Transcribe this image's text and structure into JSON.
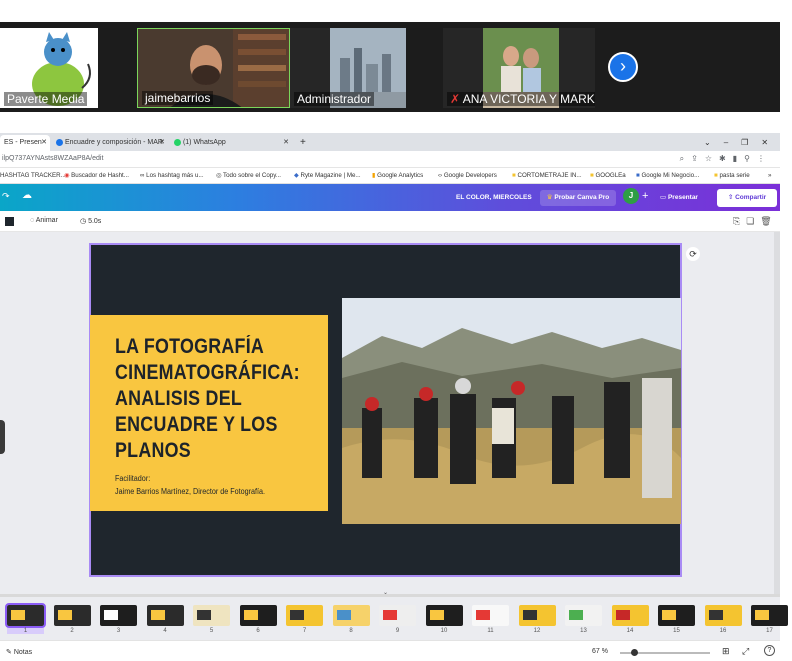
{
  "meeting": {
    "participants": [
      {
        "name": "Paverte Media"
      },
      {
        "name": "jaimebarrios"
      },
      {
        "name": "Administrador"
      },
      {
        "name": "ANA VICTORIA Y MARK"
      }
    ],
    "next_icon": "chevron-right-icon"
  },
  "browser": {
    "tabs": [
      {
        "label": "ES - Presen"
      },
      {
        "label": "Encuadre y composición - MAR"
      },
      {
        "label": "(1) WhatsApp"
      }
    ],
    "new_tab": "+",
    "url": "ilpQ737AYNAsts8WZAaP8A/edit",
    "bookmarks": [
      "HASHTAG TRACKER...",
      "Buscador de Hasht...",
      "Los hashtag más u...",
      "Todo sobre el Copy...",
      "Ryte Magazine | Me...",
      "Google Analytics",
      "Google Developers",
      "CORTOMETRAJE IN...",
      "GOOGLEa",
      "Google Mi Negocio...",
      "pasta serie"
    ]
  },
  "canva": {
    "header": {
      "design_name": "EL COLOR, MIERCOLES",
      "pro_button": "Probar Canva Pro",
      "avatar_initial": "J",
      "add_label": "+",
      "present_button": "Presentar",
      "share_button": "Compartir"
    },
    "toolbar": {
      "animate": "Animar",
      "duration": "5.0s"
    },
    "slide": {
      "title": "LA FOTOGRAFÍA CINEMATOGRÁFICA: ANALISIS DEL ENCUADRE Y LOS PLANOS",
      "facilitator_label": "Facilitador:",
      "facilitator_name": "Jaime Barrios Martínez, Director de Fotografía."
    },
    "filmstrip": {
      "numbers": [
        "1",
        "2",
        "3",
        "4",
        "5",
        "6",
        "7",
        "8",
        "9",
        "10",
        "11",
        "12",
        "13",
        "14",
        "15",
        "16",
        "17"
      ]
    },
    "footer": {
      "notes": "Notas",
      "zoom": "67 %",
      "zoom_level": 0.15
    }
  }
}
